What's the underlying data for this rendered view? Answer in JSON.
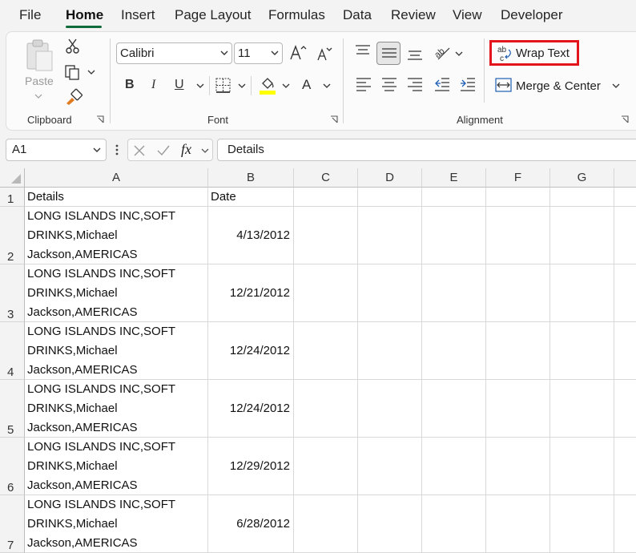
{
  "menu": {
    "tabs": [
      "File",
      "Home",
      "Insert",
      "Page Layout",
      "Formulas",
      "Data",
      "Review",
      "View",
      "Developer"
    ],
    "active": "Home"
  },
  "ribbon": {
    "clipboard": {
      "paste_label": "Paste",
      "group_label": "Clipboard"
    },
    "font": {
      "font_name": "Calibri",
      "font_size": "11",
      "bold": "B",
      "italic": "I",
      "underline": "U",
      "font_color_glyph": "A",
      "group_label": "Font"
    },
    "alignment": {
      "wrap_text_label": "Wrap Text",
      "merge_center_label": "Merge & Center",
      "group_label": "Alignment"
    }
  },
  "formula_bar": {
    "name_box": "A1",
    "fx": "fx",
    "content": "Details"
  },
  "sheet": {
    "columns": [
      "A",
      "B",
      "C",
      "D",
      "E",
      "F",
      "G"
    ],
    "header_row": {
      "row": "1",
      "a": "Details",
      "b": "Date"
    },
    "rows": [
      {
        "row": "2",
        "a": "LONG ISLANDS INC,SOFT\nDRINKS,Michael\nJackson,AMERICAS",
        "b": "4/13/2012"
      },
      {
        "row": "3",
        "a": "LONG ISLANDS INC,SOFT\nDRINKS,Michael\nJackson,AMERICAS",
        "b": "12/21/2012"
      },
      {
        "row": "4",
        "a": "LONG ISLANDS INC,SOFT\nDRINKS,Michael\nJackson,AMERICAS",
        "b": "12/24/2012"
      },
      {
        "row": "5",
        "a": "LONG ISLANDS INC,SOFT\nDRINKS,Michael\nJackson,AMERICAS",
        "b": "12/24/2012"
      },
      {
        "row": "6",
        "a": "LONG ISLANDS INC,SOFT\nDRINKS,Michael\nJackson,AMERICAS",
        "b": "12/29/2012"
      },
      {
        "row": "7",
        "a": "LONG ISLANDS INC,SOFT\nDRINKS,Michael\nJackson,AMERICAS",
        "b": "6/28/2012"
      }
    ]
  },
  "colors": {
    "accent": "#0f6b3a",
    "highlight_border": "#e3141b",
    "fill_yellow": "#ffff00"
  }
}
